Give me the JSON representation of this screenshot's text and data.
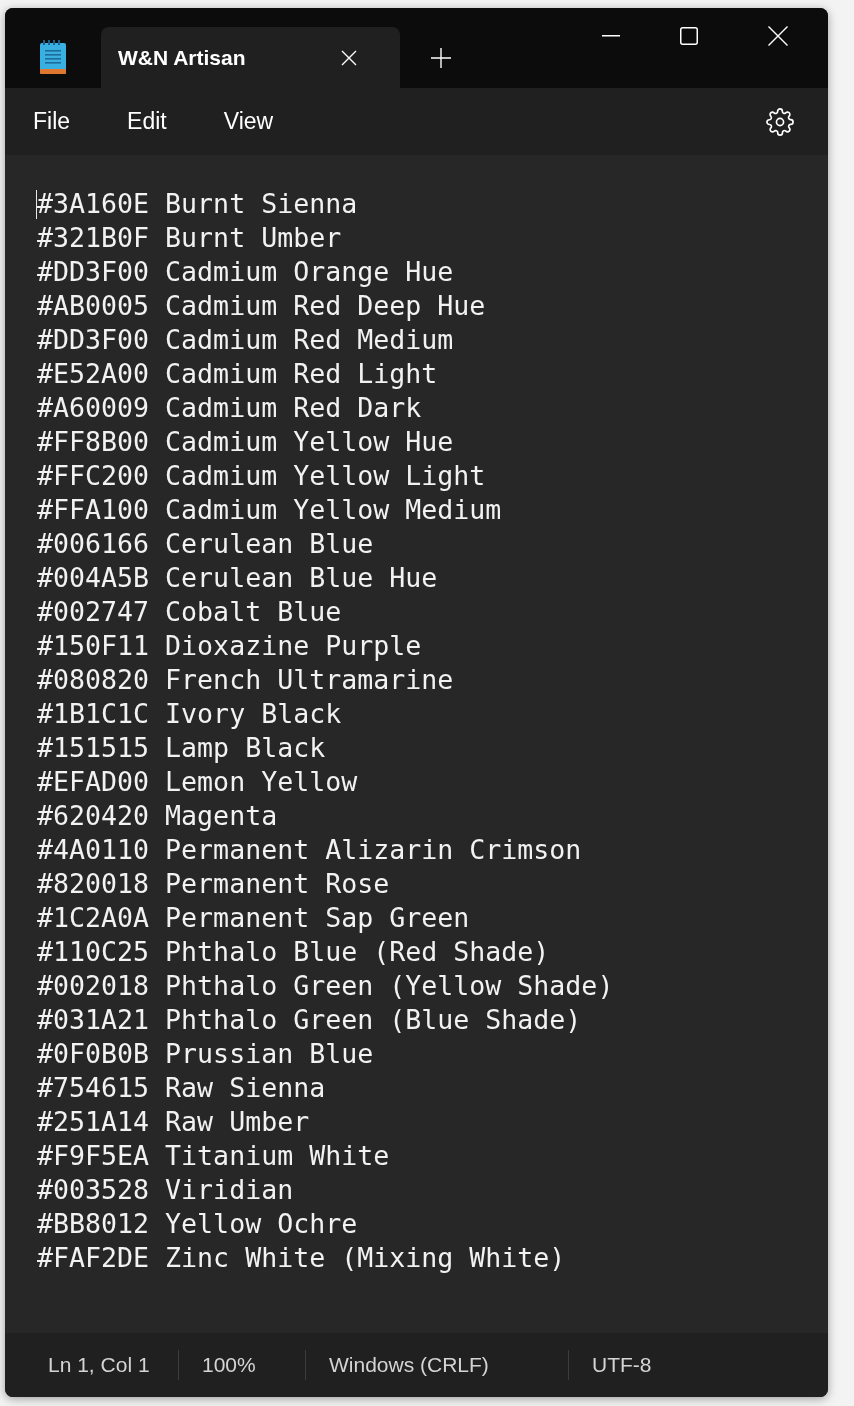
{
  "tabs": [
    {
      "title": "W&N Artisan",
      "selected": true
    }
  ],
  "menu": [
    "File",
    "Edit",
    "View"
  ],
  "editor": {
    "lines": [
      "#3A160E Burnt Sienna",
      "#321B0F Burnt Umber",
      "#DD3F00 Cadmium Orange Hue",
      "#AB0005 Cadmium Red Deep Hue",
      "#DD3F00 Cadmium Red Medium",
      "#E52A00 Cadmium Red Light",
      "#A60009 Cadmium Red Dark",
      "#FF8B00 Cadmium Yellow Hue",
      "#FFC200 Cadmium Yellow Light",
      "#FFA100 Cadmium Yellow Medium",
      "#006166 Cerulean Blue",
      "#004A5B Cerulean Blue Hue",
      "#002747 Cobalt Blue",
      "#150F11 Dioxazine Purple",
      "#080820 French Ultramarine",
      "#1B1C1C Ivory Black",
      "#151515 Lamp Black",
      "#EFAD00 Lemon Yellow",
      "#620420 Magenta",
      "#4A0110 Permanent Alizarin Crimson",
      "#820018 Permanent Rose",
      "#1C2A0A Permanent Sap Green",
      "#110C25 Phthalo Blue (Red Shade)",
      "#002018 Phthalo Green (Yellow Shade)",
      "#031A21 Phthalo Green (Blue Shade)",
      "#0F0B0B Prussian Blue",
      "#754615 Raw Sienna",
      "#251A14 Raw Umber",
      "#F9F5EA Titanium White",
      "#003528 Viridian",
      "#BB8012 Yellow Ochre",
      "#FAF2DE Zinc White (Mixing White)"
    ]
  },
  "status_bar": [
    "Ln 1, Col 1",
    "100%",
    "Windows (CRLF)",
    "UTF-8"
  ]
}
